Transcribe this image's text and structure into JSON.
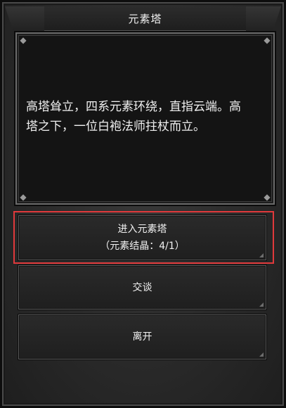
{
  "window": {
    "title": "元素塔"
  },
  "dialog": {
    "line1": "高塔耸立，四系元素环绕，直指云端。高",
    "line2": "塔之下，一位白袍法师拄杖而立。"
  },
  "options": {
    "enter": {
      "label": "进入元素塔",
      "sub": "（元素结晶：4/1）"
    },
    "talk": {
      "label": "交谈"
    },
    "leave": {
      "label": "离开"
    }
  },
  "colors": {
    "highlight": "#e0393b",
    "background": "#2a2a2a",
    "panel": "#141414",
    "text": "#f0f0f0"
  }
}
